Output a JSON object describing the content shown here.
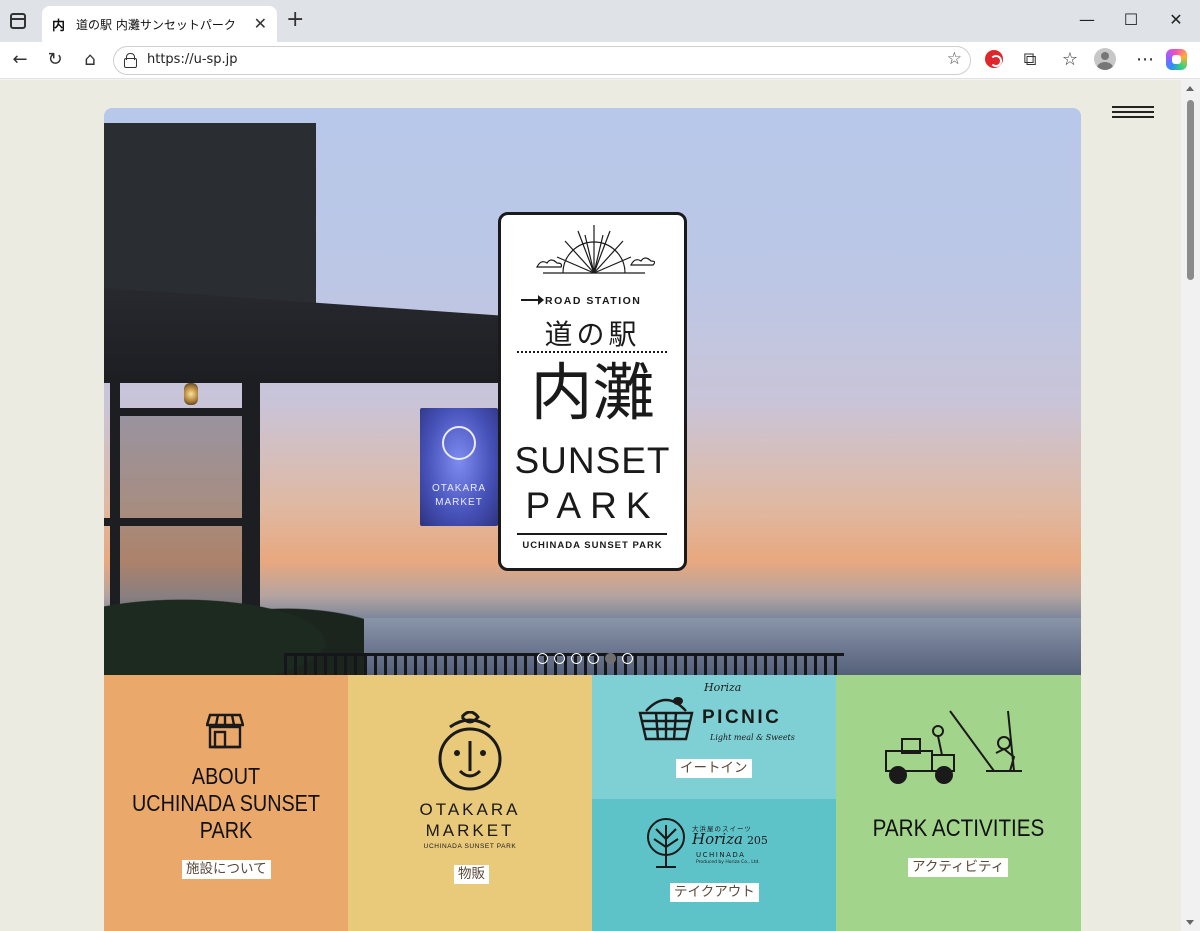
{
  "browser": {
    "tab_title": "道の駅 内灘サンセットパーク",
    "favicon_text": "内",
    "url": "https://u-sp.jp"
  },
  "hero": {
    "road_station": "ROAD STATION",
    "michi_no_eki": "道の駅",
    "uchinada": "内灘",
    "sunset": "SUNSET",
    "park": "PARK",
    "subtitle": "UCHINADA SUNSET PARK",
    "sign_text": "OTAKARA MARKET",
    "slide_count": 6,
    "active_slide": 5
  },
  "tiles": {
    "about": {
      "title_line1": "ABOUT",
      "title_line2": "UCHINADA SUNSET",
      "title_line3": "PARK",
      "tag": "施設について"
    },
    "market": {
      "name_line1": "OTAKARA",
      "name_line2": "MARKET",
      "sub": "UCHINADA SUNSET PARK",
      "tag": "物販"
    },
    "picnic": {
      "brand": "Horiza",
      "word": "PICNIC",
      "sub": "Light meal & Sweets",
      "tag": "イートイン"
    },
    "takeout": {
      "small": "大浜屋のスイーツ",
      "brand": "Horiza",
      "num": "205",
      "city": "UCHINADA",
      "note": "Produced by Horiza Co., Ltd.",
      "tag": "テイクアウト"
    },
    "activities": {
      "title": "PARK ACTIVITIES",
      "tag": "アクティビティ"
    }
  },
  "colors": {
    "about": "#eaa86a",
    "market": "#e9c97a",
    "picnic": "#7fd0d4",
    "takeout": "#5ec3c9",
    "activities": "#a3d48c",
    "page_bg": "#ecebe1"
  }
}
